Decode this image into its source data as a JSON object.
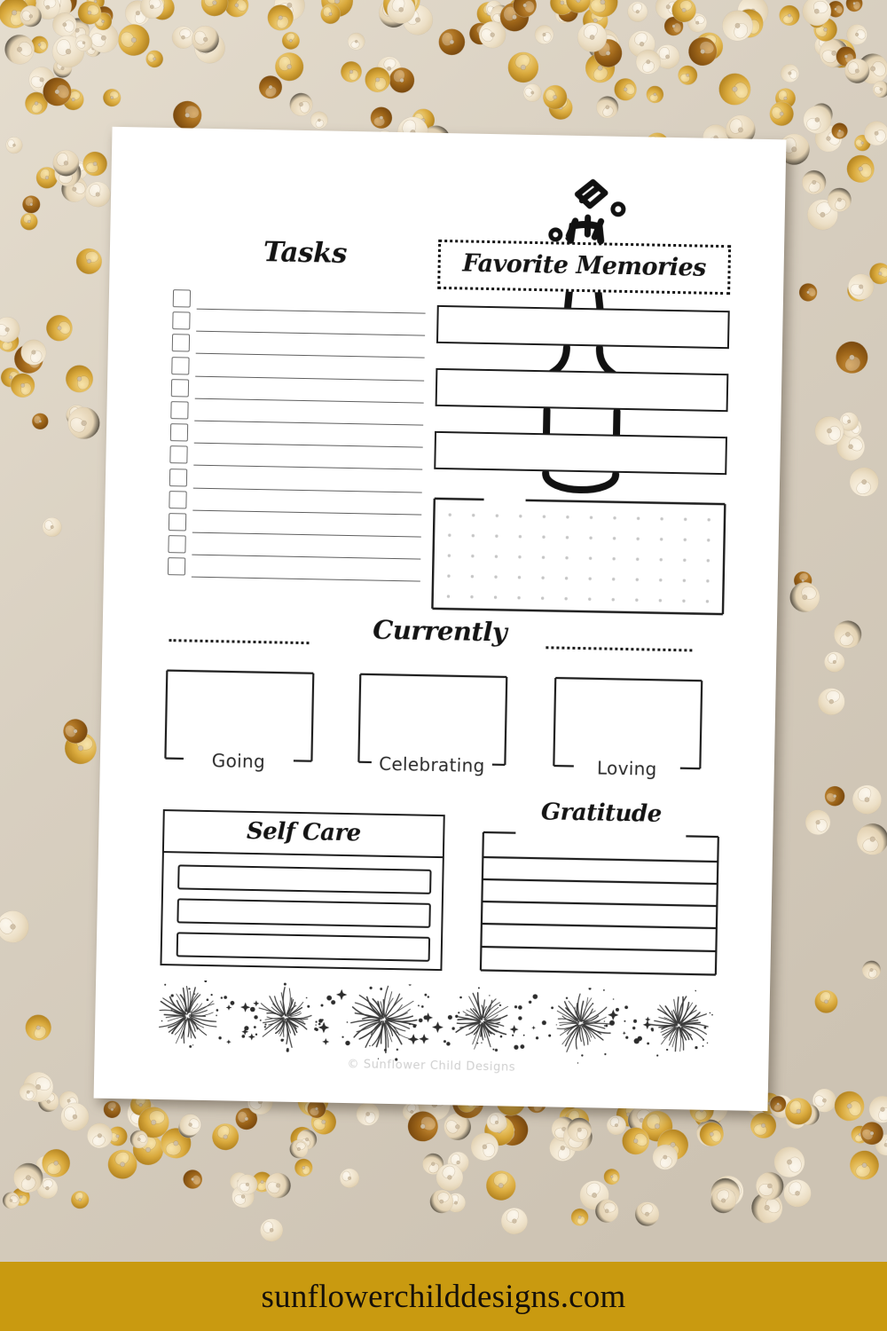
{
  "banner": {
    "website": "sunflowerchilddesigns.com",
    "background_color": "#c99a10",
    "text_color": "#15100a"
  },
  "page": {
    "background_color": "#ffffff",
    "ink_color": "#1a1a1a",
    "surface_color": "#cfc6b8",
    "credit": "© Sunflower Child Designs"
  },
  "tasks": {
    "title": "Tasks",
    "checkbox_count": 13,
    "items": [
      {
        "checked": false,
        "text": ""
      },
      {
        "checked": false,
        "text": ""
      },
      {
        "checked": false,
        "text": ""
      },
      {
        "checked": false,
        "text": ""
      },
      {
        "checked": false,
        "text": ""
      },
      {
        "checked": false,
        "text": ""
      },
      {
        "checked": false,
        "text": ""
      },
      {
        "checked": false,
        "text": ""
      },
      {
        "checked": false,
        "text": ""
      },
      {
        "checked": false,
        "text": ""
      },
      {
        "checked": false,
        "text": ""
      },
      {
        "checked": false,
        "text": ""
      },
      {
        "checked": false,
        "text": ""
      }
    ]
  },
  "favorite_memories": {
    "title": "Favorite Memories",
    "icon": "champagne-cork-pop-icon",
    "illustration": "champagne-bottle-outline",
    "boxes": [
      {
        "text": ""
      },
      {
        "text": ""
      },
      {
        "text": ""
      }
    ],
    "notes_grid": {
      "type": "dot-grid",
      "columns": 12,
      "rows": 5,
      "text": ""
    }
  },
  "currently": {
    "title": "Currently",
    "cells": [
      {
        "label": "Going",
        "value": ""
      },
      {
        "label": "Celebrating",
        "value": ""
      },
      {
        "label": "Loving",
        "value": ""
      }
    ]
  },
  "self_care": {
    "title": "Self Care",
    "slots": [
      {
        "value": ""
      },
      {
        "value": ""
      },
      {
        "value": ""
      }
    ]
  },
  "gratitude": {
    "title": "Gratitude",
    "line_count": 6,
    "lines": [
      "",
      "",
      "",
      "",
      "",
      ""
    ]
  },
  "decoration": {
    "fireworks_count": 6,
    "name": "fireworks-border"
  }
}
